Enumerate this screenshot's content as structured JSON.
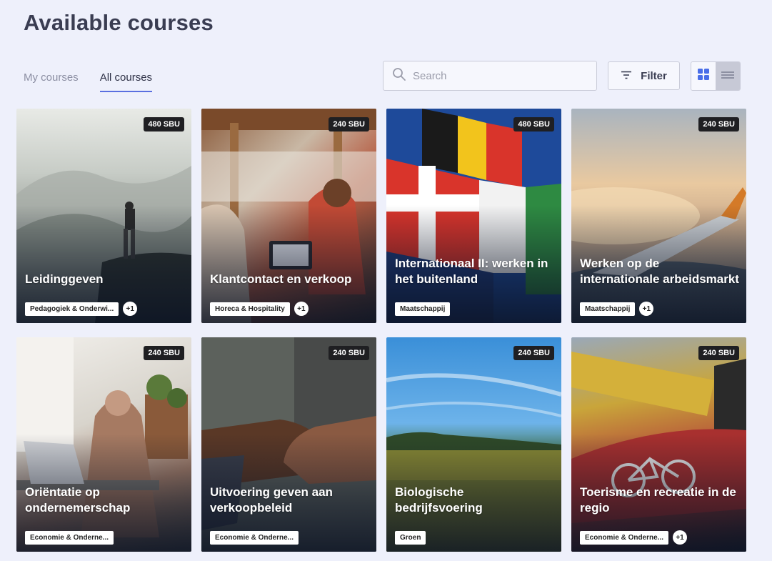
{
  "page": {
    "title": "Available courses"
  },
  "tabs": [
    {
      "label": "My courses",
      "active": false
    },
    {
      "label": "All courses",
      "active": true
    }
  ],
  "search": {
    "placeholder": "Search",
    "value": ""
  },
  "filter": {
    "label": "Filter"
  },
  "view_toggle": {
    "selected": "grid",
    "options": [
      "grid",
      "list"
    ]
  },
  "colors": {
    "accent": "#5a6fe0",
    "background": "#eef0fb",
    "badge": "#1f1f22"
  },
  "courses": [
    {
      "title": "Leidinggeven",
      "sbu": "480 SBU",
      "tags": [
        "Pedagogiek & Onderwi..."
      ],
      "more": "+1",
      "image": "person-on-mountain"
    },
    {
      "title": "Klantcontact en verkoop",
      "sbu": "240 SBU",
      "tags": [
        "Horeca & Hospitality"
      ],
      "more": "+1",
      "image": "salon-customer-service"
    },
    {
      "title": "Internationaal II: werken in het buitenland",
      "sbu": "480 SBU",
      "tags": [
        "Maatschappij"
      ],
      "more": "",
      "image": "international-flags"
    },
    {
      "title": "Werken op de internationale arbeidsmarkt",
      "sbu": "240 SBU",
      "tags": [
        "Maatschappij"
      ],
      "more": "+1",
      "image": "airplane-wing-sunset"
    },
    {
      "title": "Oriëntatie op ondernemerschap",
      "sbu": "240 SBU",
      "tags": [
        "Economie & Onderne..."
      ],
      "more": "",
      "image": "woman-at-laptop"
    },
    {
      "title": "Uitvoering geven aan verkoopbeleid",
      "sbu": "240 SBU",
      "tags": [
        "Economie & Onderne..."
      ],
      "more": "",
      "image": "handshake"
    },
    {
      "title": "Biologische bedrijfsvoering",
      "sbu": "240 SBU",
      "tags": [
        "Groen"
      ],
      "more": "",
      "image": "wheat-field"
    },
    {
      "title": "Toerisme en recreatie in de regio",
      "sbu": "240 SBU",
      "tags": [
        "Economie & Onderne..."
      ],
      "more": "+1",
      "image": "bicycle-road-sign"
    }
  ]
}
